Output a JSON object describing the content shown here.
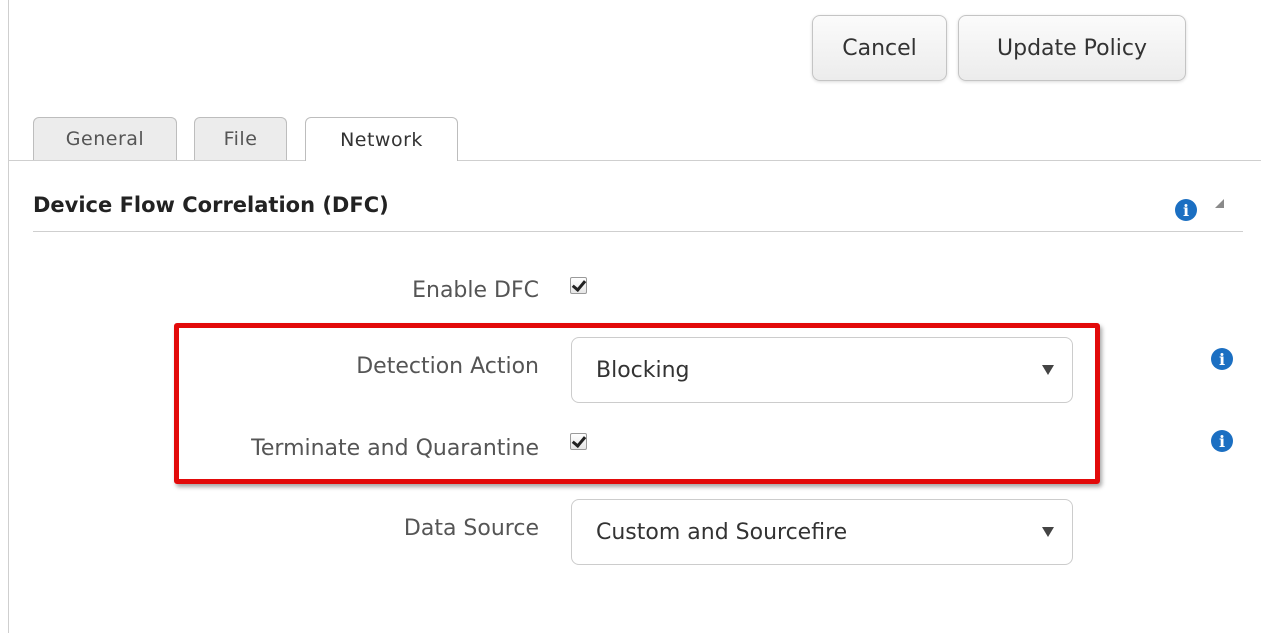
{
  "toolbar": {
    "cancel_label": "Cancel",
    "update_label": "Update Policy"
  },
  "tabs": [
    {
      "label": "General",
      "active": false
    },
    {
      "label": "File",
      "active": false
    },
    {
      "label": "Network",
      "active": true
    }
  ],
  "section": {
    "title": "Device Flow Correlation (DFC)",
    "info_icon": "info-icon",
    "collapse_icon": "collapse-caret-icon"
  },
  "form": {
    "enable_dfc": {
      "label": "Enable DFC",
      "checked": true
    },
    "detection_action": {
      "label": "Detection Action",
      "value": "Blocking",
      "info_icon": "info-icon"
    },
    "terminate_quarantine": {
      "label": "Terminate and Quarantine",
      "checked": true,
      "info_icon": "info-icon"
    },
    "data_source": {
      "label": "Data Source",
      "value": "Custom and Sourcefire"
    }
  },
  "colors": {
    "info_icon": "#1b6fc2",
    "highlight_border": "#e20a0a",
    "active_tab_bg": "#ffffff",
    "inactive_tab_bg": "#ececec"
  }
}
